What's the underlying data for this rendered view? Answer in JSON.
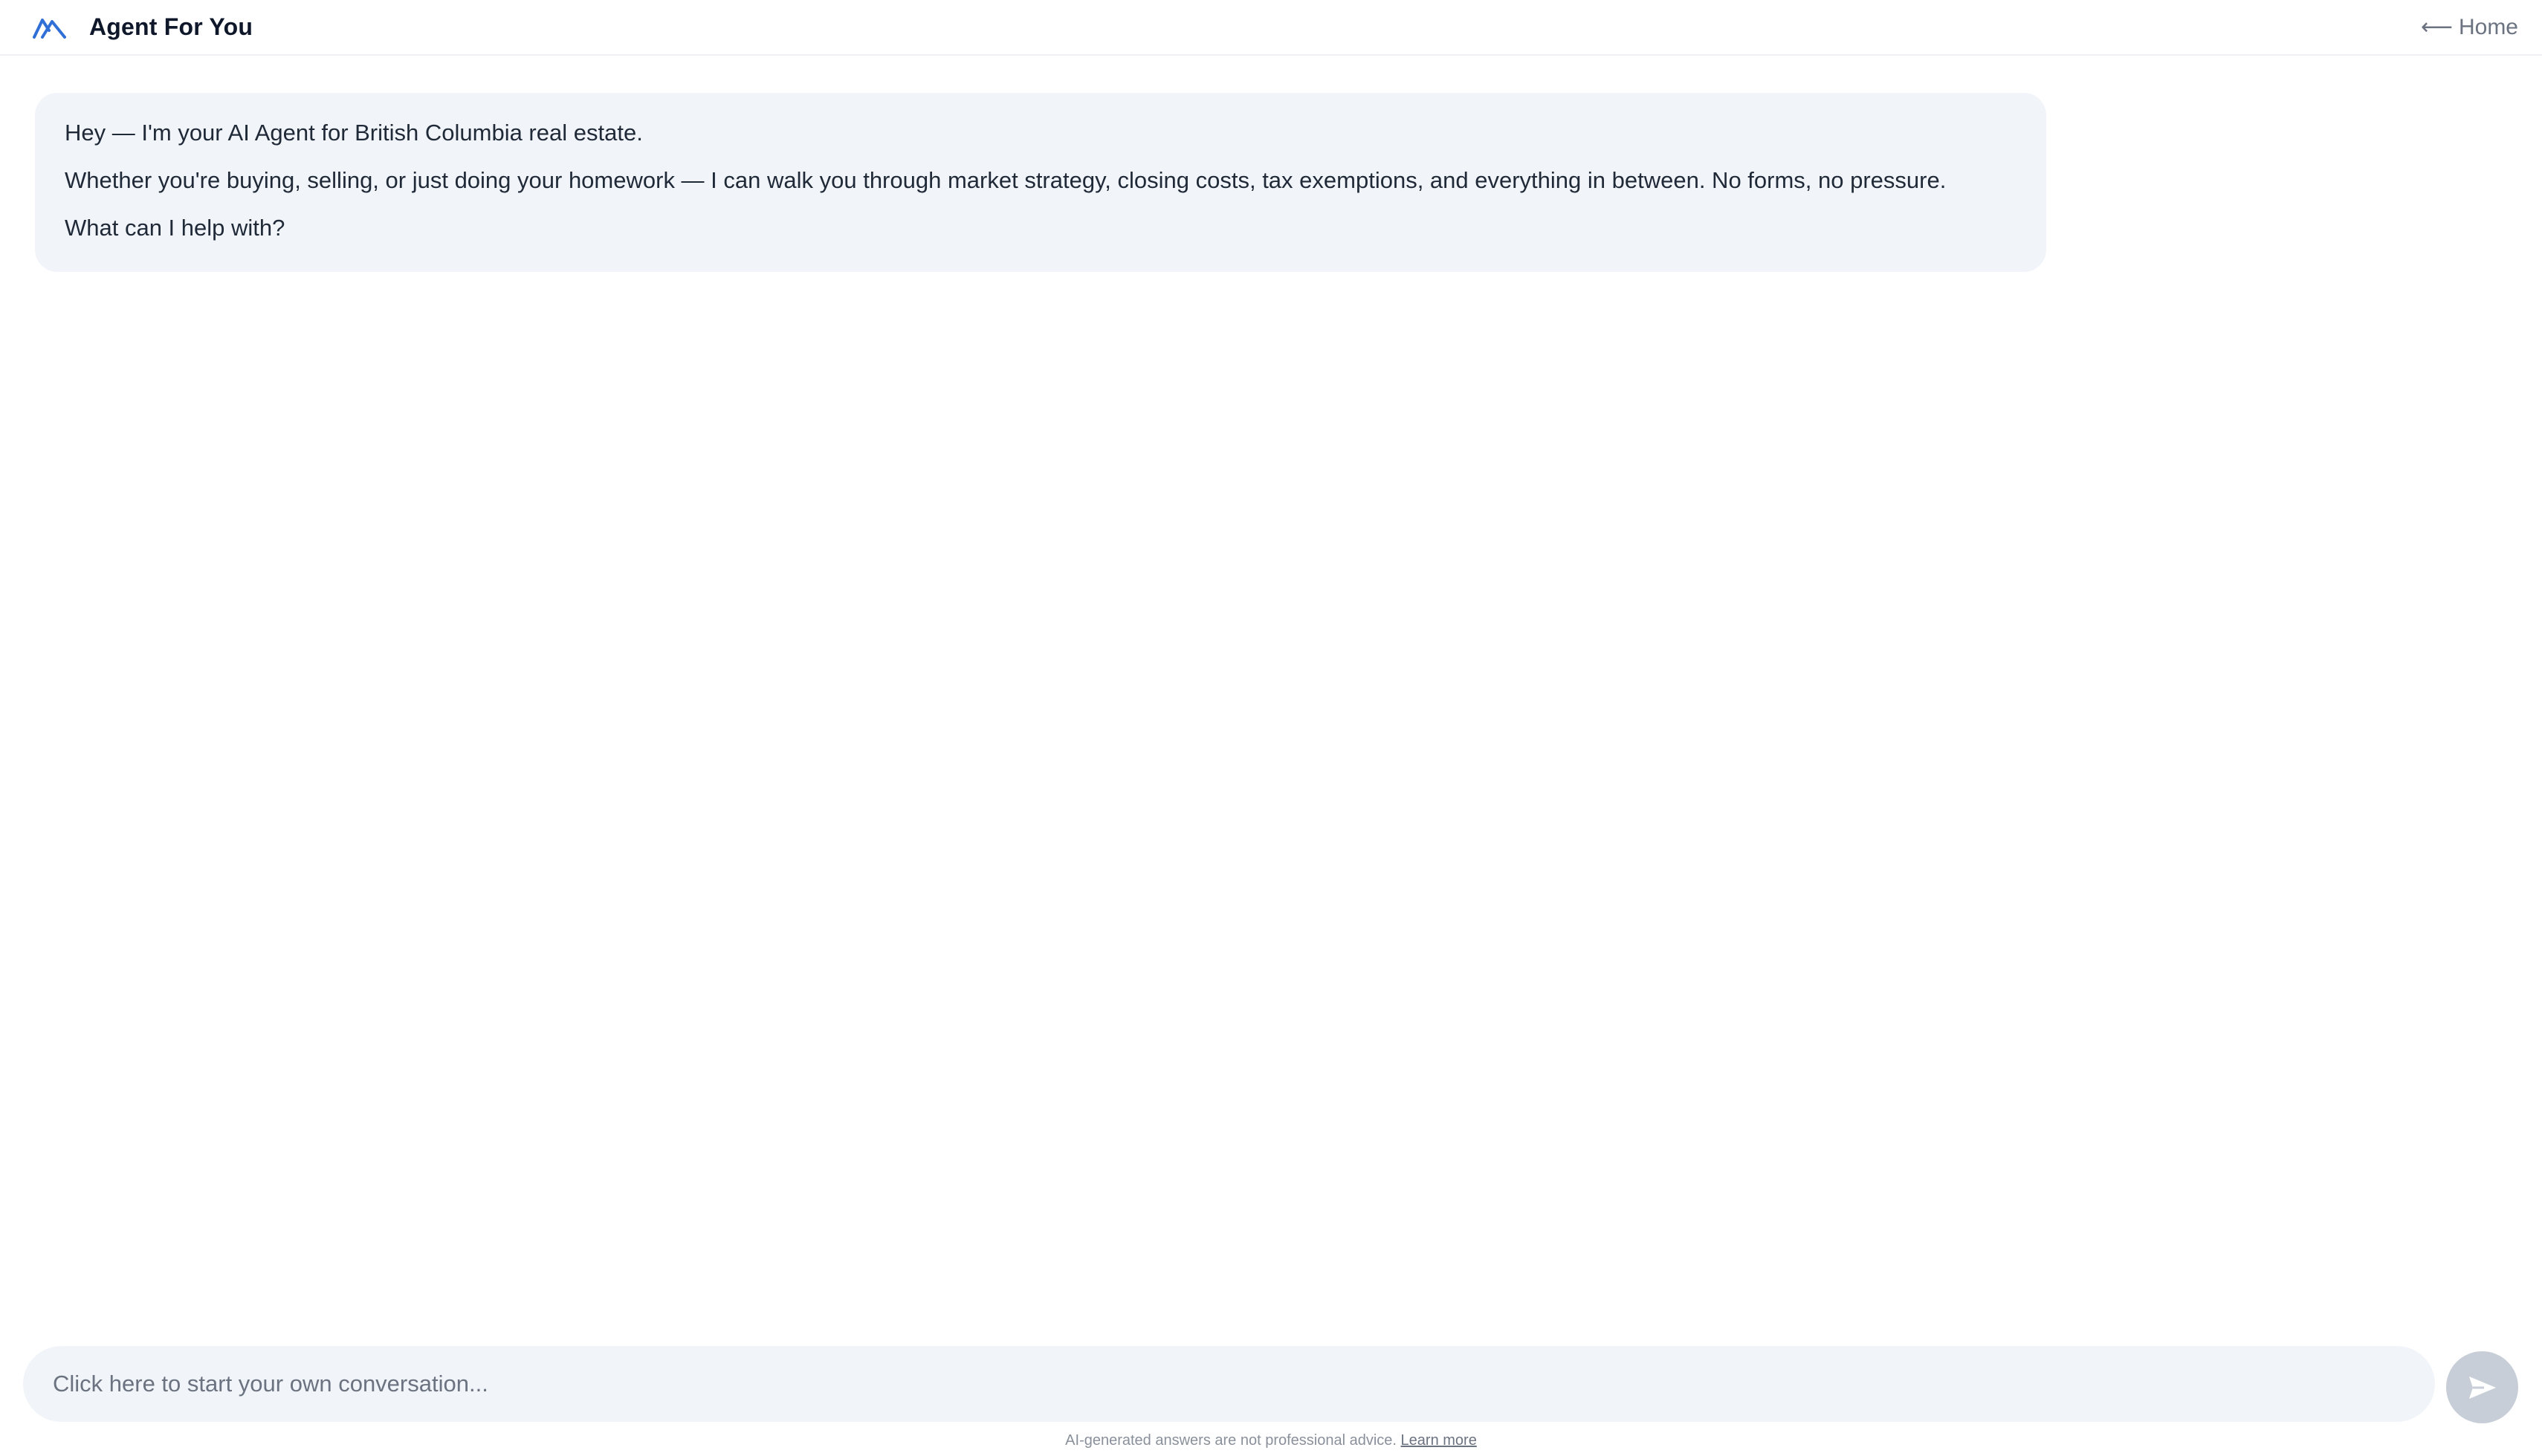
{
  "header": {
    "logo_icon": "mountain-logo-icon",
    "brand": "Agent For You",
    "home_arrow": "⟵",
    "home_label": "Home"
  },
  "chat": {
    "messages": [
      {
        "role": "assistant",
        "paragraphs": [
          "Hey — I'm your AI Agent for British Columbia real estate.",
          "Whether you're buying, selling, or just doing your homework — I can walk you through market strategy, closing costs, tax exemptions, and everything in between. No forms, no pressure.",
          "What can I help with?"
        ]
      }
    ]
  },
  "composer": {
    "placeholder": "Click here to start your own conversation...",
    "value": "",
    "send_icon": "send-icon"
  },
  "footer": {
    "disclaimer": "AI-generated answers are not professional advice.",
    "learn_more": "Learn more"
  },
  "colors": {
    "accent": "#2f6fd6",
    "bubble_bg": "#f1f4f9",
    "send_button_bg": "#c8ced8"
  }
}
